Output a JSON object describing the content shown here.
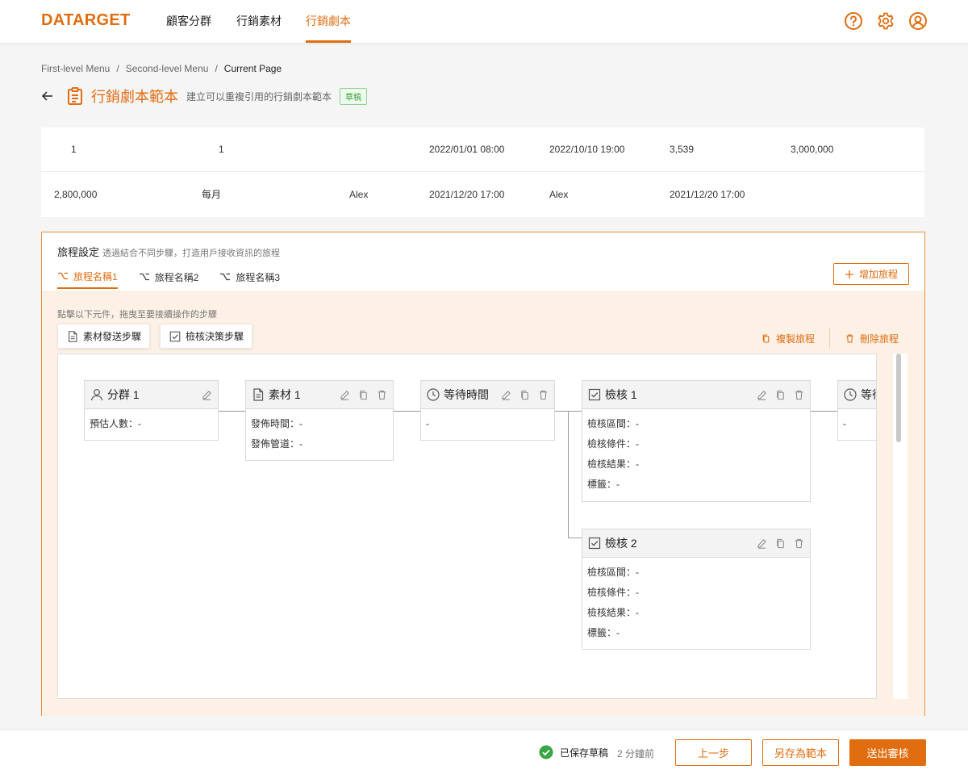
{
  "app": {
    "logo": "DATARGET",
    "nav": [
      {
        "label": "顧客分群"
      },
      {
        "label": "行銷素材"
      },
      {
        "label": "行銷劇本"
      }
    ]
  },
  "colors": {
    "accent": "#e06d10",
    "success": "#3aa545"
  },
  "breadcrumb": {
    "items": [
      "First-level Menu",
      "Second-level Menu",
      "Current Page"
    ],
    "separator": "/"
  },
  "page": {
    "title": "行銷劇本範本",
    "subtitle": "建立可以重複引用的行銷劇本範本",
    "badge": "草稿"
  },
  "info": {
    "row1": [
      "1",
      "1",
      "2022/01/01 08:00",
      "2022/10/10 19:00",
      "3,539",
      "3,000,000"
    ],
    "row2": [
      "2,800,000",
      "每月",
      "Alex",
      "2021/12/20 17:00",
      "Alex",
      "2021/12/20 17:00"
    ]
  },
  "journey": {
    "title": "旅程設定",
    "desc": "透過結合不同步驟，打造用戶接收資訊的旅程",
    "tabs": [
      {
        "label": "旅程名稱1"
      },
      {
        "label": "旅程名稱2"
      },
      {
        "label": "旅程名稱3"
      }
    ],
    "add_label": "增加旅程",
    "hint": "點擊以下元件，拖曳至要接續操作的步驟",
    "palette": [
      {
        "label": "素材發送步驟",
        "icon": "document-icon"
      },
      {
        "label": "檢核決策步驟",
        "icon": "checkbox-icon"
      }
    ],
    "copy_label": "複製旅程",
    "delete_label": "刪除旅程"
  },
  "flow": {
    "nodes": [
      {
        "title": "分群 1",
        "icon": "user-icon",
        "lines": [
          "預估人數：-"
        ]
      },
      {
        "title": "素材 1",
        "icon": "document-icon",
        "lines": [
          "發佈時間：-",
          "發佈管道：-"
        ]
      },
      {
        "title": "等待時間",
        "icon": "clock-icon",
        "lines": [
          "-"
        ]
      },
      {
        "title": "檢核 1",
        "icon": "checkbox-icon",
        "lines": [
          "檢核區間：-",
          "檢核條件：-",
          "檢核結果：-",
          "標籤：-"
        ]
      },
      {
        "title": "等待時間",
        "icon": "clock-icon",
        "lines": [
          "-"
        ]
      },
      {
        "title": "檢核 2",
        "icon": "checkbox-icon",
        "lines": [
          "檢核區間：-",
          "檢核條件：-",
          "檢核結果：-",
          "標籤：-"
        ]
      }
    ]
  },
  "footer": {
    "saved_label": "已保存草稿",
    "saved_time": "2 分鐘前",
    "prev_label": "上一步",
    "save_template_label": "另存為範本",
    "submit_label": "送出審核"
  }
}
